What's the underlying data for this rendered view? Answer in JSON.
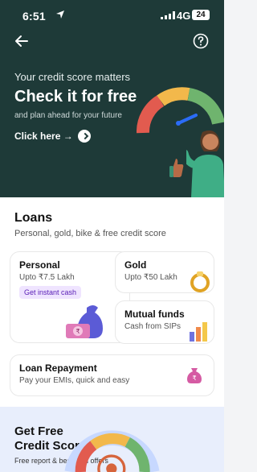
{
  "status_bar": {
    "time": "6:51",
    "network": "4G",
    "battery": "24"
  },
  "hero": {
    "subtitle": "Your credit score matters",
    "title": "Check it for free",
    "tagline": "and plan ahead for your future",
    "cta": "Click here →"
  },
  "loans": {
    "title": "Loans",
    "subtitle": "Personal, gold, bike & free credit score",
    "cards": [
      {
        "title": "Personal",
        "desc": "Upto ₹7.5 Lakh",
        "badge": "Get instant cash"
      },
      {
        "title": "Gold",
        "desc": "Upto ₹50 Lakh"
      },
      {
        "title": "Mutual funds",
        "desc": "Cash from SIPs"
      }
    ],
    "repayment": {
      "title": "Loan Repayment",
      "desc": "Pay your EMIs, quick and easy"
    }
  },
  "free_score": {
    "line1": "Get Free",
    "line2": "Credit Score",
    "desc": "Free report & best loan offers"
  },
  "colors": {
    "hero_bg": "#1e3a38",
    "accent_purple": "#7c3aed",
    "gauge_red": "#e25b4f",
    "gauge_yellow": "#f2b84b",
    "gauge_green": "#6fb46e"
  }
}
